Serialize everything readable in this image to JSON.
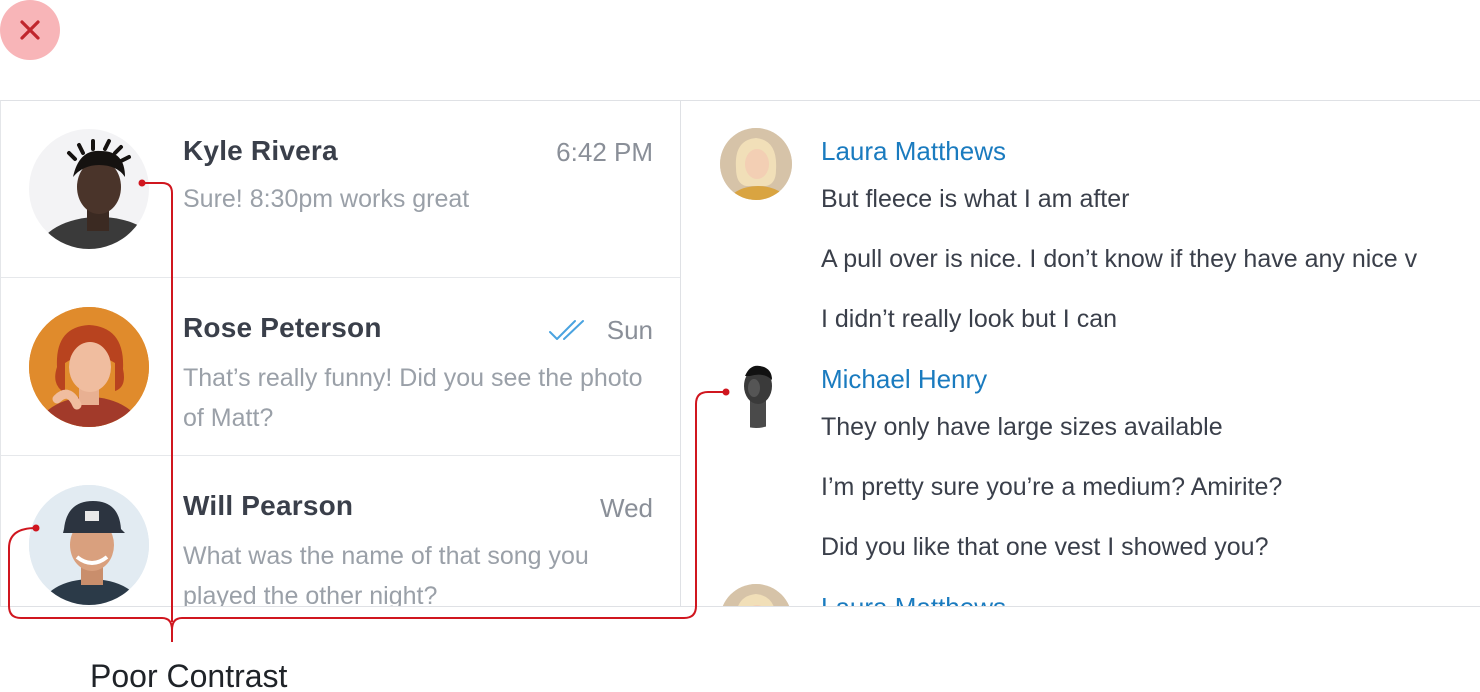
{
  "badge": {
    "icon": "close-icon",
    "color": "#c0262d",
    "background": "#f8b5b8"
  },
  "conversations": [
    {
      "name": "Kyle Rivera",
      "time": "6:42 PM",
      "preview": "Sure! 8:30pm works great",
      "read_receipt": false
    },
    {
      "name": "Rose Peterson",
      "time": "Sun",
      "preview": "That’s really funny! Did you see the photo of Matt?",
      "read_receipt": true
    },
    {
      "name": "Will Pearson",
      "time": "Wed",
      "preview": "What was the name of that song you played the other night?",
      "read_receipt": false
    }
  ],
  "thread": [
    {
      "sender": "Laura Matthews",
      "messages": [
        "But fleece is what I am after",
        "A pull over is nice. I don’t know if they have any nice v",
        "I didn’t really look but I can"
      ]
    },
    {
      "sender": "Michael Henry",
      "messages": [
        "They only have large sizes available",
        "I’m pretty sure you’re a medium? Amirite?",
        "Did you like that one vest I showed you?"
      ]
    },
    {
      "sender": "Laura Matthews",
      "messages": []
    }
  ],
  "annotation": {
    "label": "Poor Contrast",
    "color": "#d0161f"
  },
  "colors": {
    "sender": "#1a7bbf",
    "preview": "#9aa0a8",
    "time": "#8a8f98",
    "check": "#4aa3e0"
  }
}
